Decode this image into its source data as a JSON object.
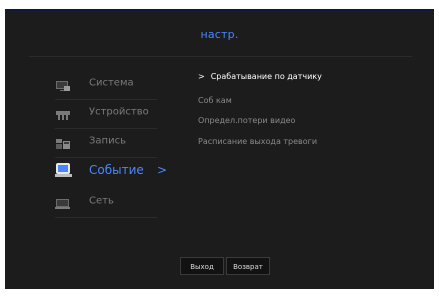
{
  "title": "настр.",
  "menu": [
    {
      "label": "Система",
      "icon": "monitor-system-icon",
      "active": false
    },
    {
      "label": "Устройство",
      "icon": "camera-device-icon",
      "active": false
    },
    {
      "label": "Запись",
      "icon": "record-icon",
      "active": false
    },
    {
      "label": "Событие",
      "icon": "event-icon",
      "active": true,
      "chevron": ">"
    },
    {
      "label": "Сеть",
      "icon": "network-icon",
      "active": false
    }
  ],
  "submenu": {
    "selected_mark": ">",
    "items": [
      {
        "label": "Срабатывание по датчику",
        "selected": true
      },
      {
        "label": "Соб кам",
        "selected": false
      },
      {
        "label": "Определ.потери видео",
        "selected": false
      },
      {
        "label": "Расписание выхода тревоги",
        "selected": false
      }
    ]
  },
  "buttons": {
    "exit": "Выход",
    "back": "Возврат"
  },
  "colors": {
    "accent": "#4b86ff",
    "background": "#1c1c1c",
    "text_dim": "#7a7a7a",
    "text_selected": "#ffffff"
  }
}
